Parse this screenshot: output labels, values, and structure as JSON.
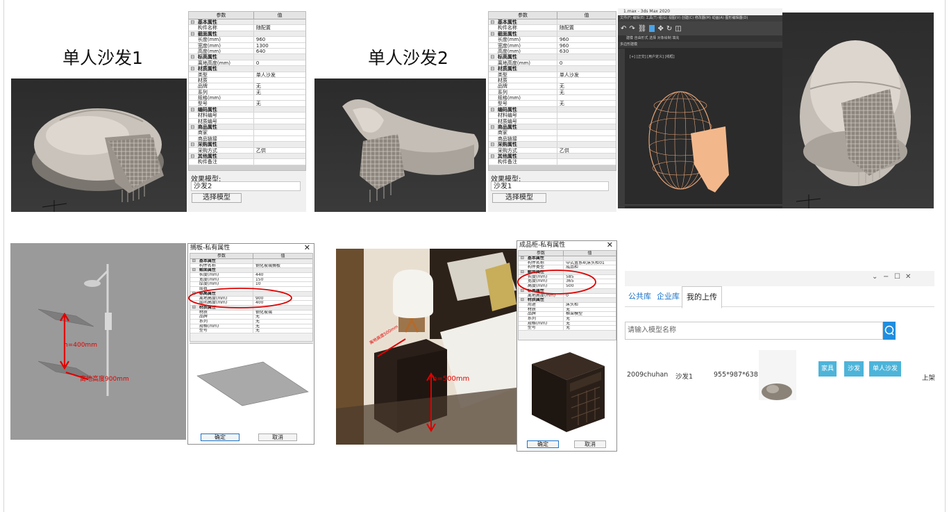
{
  "titles": {
    "sofa1": "单人沙发1",
    "sofa2": "单人沙发2"
  },
  "panel1": {
    "header": {
      "param": "参数",
      "value": "值"
    },
    "rows": [
      {
        "t": "sec",
        "k": "基本属性",
        "v": ""
      },
      {
        "t": "r",
        "k": "构件名称",
        "v": "随配置"
      },
      {
        "t": "sec",
        "k": "截面属性",
        "v": ""
      },
      {
        "t": "r",
        "k": "长度(mm)",
        "v": "960"
      },
      {
        "t": "r",
        "k": "宽度(mm)",
        "v": "1300"
      },
      {
        "t": "r",
        "k": "高度(mm)",
        "v": "640"
      },
      {
        "t": "sec",
        "k": "标高属性",
        "v": ""
      },
      {
        "t": "r",
        "k": "离地高度(mm)",
        "v": "0"
      },
      {
        "t": "sec",
        "k": "材质属性",
        "v": ""
      },
      {
        "t": "r",
        "k": "类型",
        "v": "单人沙发"
      },
      {
        "t": "r",
        "k": "材质",
        "v": ""
      },
      {
        "t": "r",
        "k": "品牌",
        "v": "无"
      },
      {
        "t": "r",
        "k": "系列",
        "v": "无"
      },
      {
        "t": "r",
        "k": "规格(mm)",
        "v": ""
      },
      {
        "t": "r",
        "k": "型号",
        "v": "无"
      },
      {
        "t": "sec",
        "k": "编码属性",
        "v": ""
      },
      {
        "t": "r",
        "k": "材料编号",
        "v": ""
      },
      {
        "t": "r",
        "k": "材质编号",
        "v": ""
      },
      {
        "t": "sec",
        "k": "商品属性",
        "v": ""
      },
      {
        "t": "r",
        "k": "商家",
        "v": ""
      },
      {
        "t": "r",
        "k": "商品链接",
        "v": ""
      },
      {
        "t": "sec",
        "k": "采购属性",
        "v": ""
      },
      {
        "t": "r",
        "k": "采购方式",
        "v": "乙供"
      },
      {
        "t": "sec",
        "k": "其他属性",
        "v": ""
      },
      {
        "t": "r",
        "k": "构件备注",
        "v": ""
      }
    ],
    "effect_label": "效果模型:",
    "effect_value": "沙发2",
    "select_btn": "选择模型"
  },
  "panel2": {
    "header": {
      "param": "参数",
      "value": "值"
    },
    "rows": [
      {
        "t": "sec",
        "k": "基本属性",
        "v": ""
      },
      {
        "t": "r",
        "k": "构件名称",
        "v": "随配置"
      },
      {
        "t": "sec",
        "k": "截面属性",
        "v": ""
      },
      {
        "t": "r",
        "k": "长度(mm)",
        "v": "960"
      },
      {
        "t": "r",
        "k": "宽度(mm)",
        "v": "960"
      },
      {
        "t": "r",
        "k": "高度(mm)",
        "v": "630"
      },
      {
        "t": "sec",
        "k": "标高属性",
        "v": ""
      },
      {
        "t": "r",
        "k": "离地高度(mm)",
        "v": "0"
      },
      {
        "t": "sec",
        "k": "材质属性",
        "v": ""
      },
      {
        "t": "r",
        "k": "类型",
        "v": "单人沙发"
      },
      {
        "t": "r",
        "k": "材质",
        "v": ""
      },
      {
        "t": "r",
        "k": "品牌",
        "v": "无"
      },
      {
        "t": "r",
        "k": "系列",
        "v": "无"
      },
      {
        "t": "r",
        "k": "规格(mm)",
        "v": ""
      },
      {
        "t": "r",
        "k": "型号",
        "v": "无"
      },
      {
        "t": "sec",
        "k": "编码属性",
        "v": ""
      },
      {
        "t": "r",
        "k": "材料编号",
        "v": ""
      },
      {
        "t": "r",
        "k": "材质编号",
        "v": ""
      },
      {
        "t": "sec",
        "k": "商品属性",
        "v": ""
      },
      {
        "t": "r",
        "k": "商家",
        "v": ""
      },
      {
        "t": "r",
        "k": "商品链接",
        "v": ""
      },
      {
        "t": "sec",
        "k": "采购属性",
        "v": ""
      },
      {
        "t": "r",
        "k": "采购方式",
        "v": "乙供"
      },
      {
        "t": "sec",
        "k": "其他属性",
        "v": ""
      },
      {
        "t": "r",
        "k": "构件备注",
        "v": ""
      }
    ],
    "effect_label": "效果模型:",
    "effect_value": "沙发1",
    "select_btn": "选择模型"
  },
  "max": {
    "title": "1.max - 3ds Max 2020",
    "menu": "文件(F)  编辑(E)  工具(T)  组(G)  视图(V)  创建(C)  修改器(M)  动画(A)  图形编辑器(D)",
    "ribbon": "建模   自由形式   选择   对象绘制   填充",
    "sub": "多边形建模",
    "viewport_label": "[+] [正交] [用户定义] [线框]"
  },
  "shelf": {
    "dim_label": "h=400mm",
    "ground_label": "离地高度900mm",
    "dialog_title": "搁板-私有属性",
    "header": {
      "param": "参数",
      "value": "值"
    },
    "rows": [
      {
        "t": "sec",
        "k": "基本属性",
        "v": ""
      },
      {
        "t": "r",
        "k": "构件名称",
        "v": "钢化玻璃搁板"
      },
      {
        "t": "sec",
        "k": "截面属性",
        "v": ""
      },
      {
        "t": "r",
        "k": "长度(mm)",
        "v": "440"
      },
      {
        "t": "r",
        "k": "宽度(mm)",
        "v": "150"
      },
      {
        "t": "r",
        "k": "厚度(mm)",
        "v": "10"
      },
      {
        "t": "r",
        "k": "层数",
        "v": ""
      },
      {
        "t": "sec",
        "k": "标高属性",
        "v": ""
      },
      {
        "t": "r",
        "k": "离地高度(mm)",
        "v": "900"
      },
      {
        "t": "r",
        "k": "层间高度(mm)",
        "v": "400"
      },
      {
        "t": "sec",
        "k": "材质属性",
        "v": ""
      },
      {
        "t": "r",
        "k": "材质",
        "v": "钢化玻璃"
      },
      {
        "t": "r",
        "k": "品牌",
        "v": "无"
      },
      {
        "t": "r",
        "k": "系列",
        "v": "无"
      },
      {
        "t": "r",
        "k": "规格(mm)",
        "v": "无"
      },
      {
        "t": "r",
        "k": "型号",
        "v": "无"
      }
    ],
    "ok": "确定",
    "cancel": "取消"
  },
  "nightstand": {
    "dim_label": "h=500mm",
    "ground_label": "离地高度500mm",
    "dialog_title": "成品柜-私有属性",
    "header": {
      "param": "参数",
      "value": "值"
    },
    "rows": [
      {
        "t": "sec",
        "k": "基本属性",
        "v": ""
      },
      {
        "t": "r",
        "k": "构件名称",
        "v": "中式置系4(床头柜01"
      },
      {
        "t": "r",
        "k": "构件类型",
        "v": "成品柜"
      },
      {
        "t": "sec",
        "k": "截面属性",
        "v": ""
      },
      {
        "t": "r",
        "k": "长度(mm)",
        "v": "585"
      },
      {
        "t": "r",
        "k": "宽度(mm)",
        "v": "365"
      },
      {
        "t": "r",
        "k": "高度(mm)",
        "v": "500"
      },
      {
        "t": "sec",
        "k": "标高属性",
        "v": ""
      },
      {
        "t": "r",
        "k": "离地高度(mm)",
        "v": "0"
      },
      {
        "t": "sec",
        "k": "材质属性",
        "v": ""
      },
      {
        "t": "r",
        "k": "用途",
        "v": "床头柜"
      },
      {
        "t": "r",
        "k": "材质",
        "v": "无"
      },
      {
        "t": "r",
        "k": "品牌",
        "v": "框架模型"
      },
      {
        "t": "r",
        "k": "系列",
        "v": "无"
      },
      {
        "t": "r",
        "k": "规格(mm)",
        "v": "无"
      },
      {
        "t": "r",
        "k": "型号",
        "v": "无"
      }
    ],
    "ok": "确定",
    "cancel": "取消"
  },
  "upload": {
    "tabs": [
      "公共库",
      "企业库",
      "我的上传"
    ],
    "search_placeholder": "请输入模型名称",
    "row": {
      "user": "2009chuhan",
      "name": "沙发1",
      "size": "955*987*638",
      "tags": [
        "家具",
        "沙发",
        "单人沙发"
      ],
      "status": "上架"
    }
  }
}
